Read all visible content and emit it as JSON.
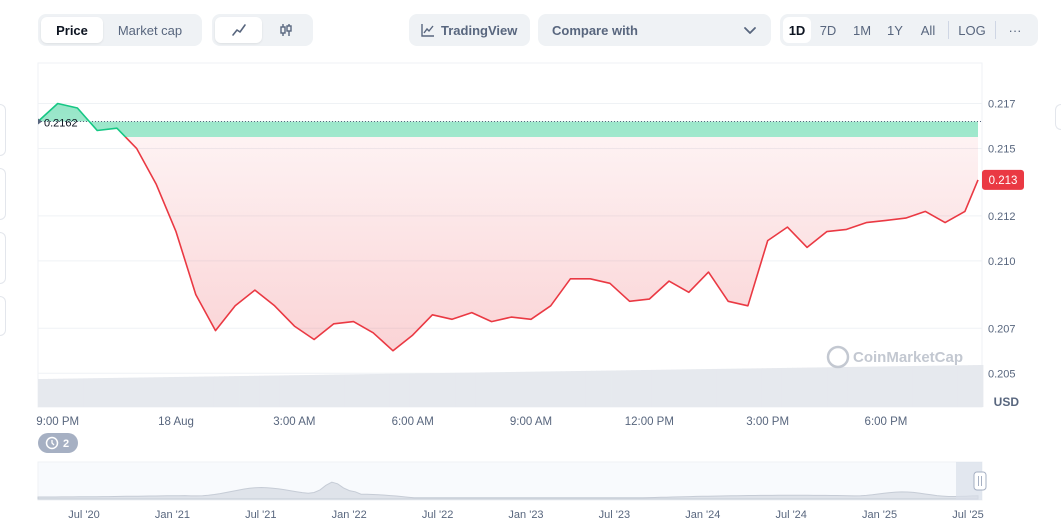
{
  "toolbar": {
    "price_label": "Price",
    "market_cap_label": "Market cap",
    "line_chart_icon": "line-chart-icon",
    "candlestick_icon": "candlestick-icon",
    "tradingview_label": "TradingView",
    "compare_label": "Compare with",
    "ranges": [
      "1D",
      "7D",
      "1M",
      "1Y",
      "All"
    ],
    "active_range": "1D",
    "log_label": "LOG",
    "more_label": "···"
  },
  "chart": {
    "open_price_label": "0.2162",
    "current_price_label": "0.213",
    "currency_label": "USD",
    "watermark": "CoinMarketCap",
    "events_count": "2",
    "y_ticks": [
      "0.217",
      "0.215",
      "0.212",
      "0.210",
      "0.207",
      "0.205"
    ],
    "x_ticks": [
      "9:00 PM",
      "18 Aug",
      "3:00 AM",
      "6:00 AM",
      "9:00 AM",
      "12:00 PM",
      "3:00 PM",
      "6:00 PM"
    ],
    "nav_ticks": [
      "Jul '20",
      "Jan '21",
      "Jul '21",
      "Jan '22",
      "Jul '22",
      "Jan '23",
      "Jul '23",
      "Jan '24",
      "Jul '24",
      "Jan '25",
      "Jul '25"
    ],
    "colors": {
      "up": "#16c784",
      "down": "#ea3943",
      "grid": "#eff2f5"
    }
  },
  "chart_data": {
    "type": "area",
    "title": "",
    "ylabel": "USD",
    "ylim": [
      0.2035,
      0.2188
    ],
    "baseline": 0.2162,
    "x": [
      "20:30",
      "21:00",
      "21:30",
      "22:00",
      "22:30",
      "23:00",
      "23:30",
      "00:00",
      "00:30",
      "01:00",
      "01:30",
      "02:00",
      "02:30",
      "03:00",
      "03:30",
      "04:00",
      "04:30",
      "05:00",
      "05:30",
      "06:00",
      "06:30",
      "07:00",
      "07:30",
      "08:00",
      "08:30",
      "09:00",
      "09:30",
      "10:00",
      "10:30",
      "11:00",
      "11:30",
      "12:00",
      "12:30",
      "13:00",
      "13:30",
      "14:00",
      "14:30",
      "15:00",
      "15:30",
      "16:00",
      "16:30",
      "17:00",
      "17:30",
      "18:00",
      "18:30",
      "19:00",
      "19:30",
      "20:00",
      "20:20"
    ],
    "values": [
      0.2162,
      0.217,
      0.2168,
      0.2158,
      0.2159,
      0.215,
      0.2134,
      0.2113,
      0.2085,
      0.2069,
      0.208,
      0.2087,
      0.208,
      0.2071,
      0.2065,
      0.2072,
      0.2073,
      0.2068,
      0.206,
      0.2067,
      0.2076,
      0.2074,
      0.2077,
      0.2073,
      0.2075,
      0.2074,
      0.208,
      0.2092,
      0.2092,
      0.209,
      0.2082,
      0.2083,
      0.2091,
      0.2086,
      0.2095,
      0.2082,
      0.208,
      0.2109,
      0.2115,
      0.2106,
      0.2113,
      0.2114,
      0.2117,
      0.2118,
      0.2119,
      0.2122,
      0.2117,
      0.2122,
      0.2136
    ],
    "volume_trend": "rising",
    "navigator_trend": "historical price (Jul 2020 - Jul 2025)"
  }
}
